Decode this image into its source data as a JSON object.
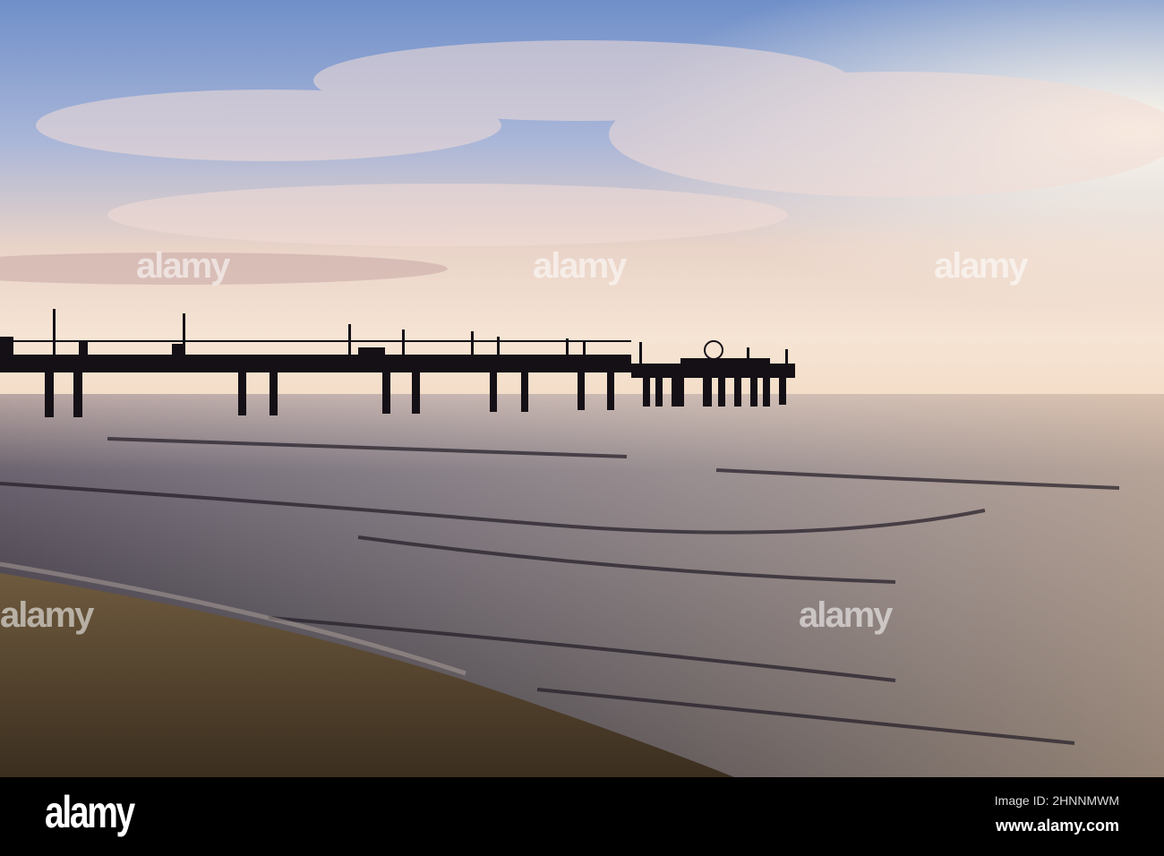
{
  "watermark": {
    "logo": "alamy",
    "text": "alamy"
  },
  "footer": {
    "logo": "alamy",
    "image_id": "Image ID: 2HNNMWM",
    "website": "www.alamy.com"
  }
}
